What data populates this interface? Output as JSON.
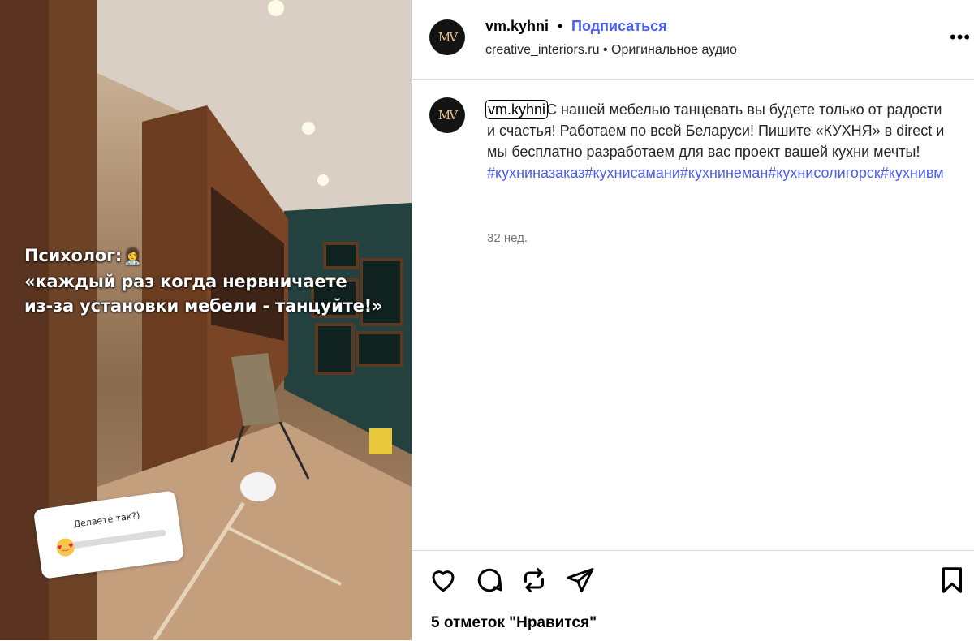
{
  "video": {
    "overlay_line1": "Психолог:",
    "overlay_line2": "«каждый раз когда нервничаете",
    "overlay_line3": "из-за установки мебели - танцуйте!»",
    "slider_question": "Делаете так?)",
    "slider_value": 0.0
  },
  "header": {
    "avatar_monogram": "MV",
    "username": "vm.kyhni",
    "separator": "•",
    "follow_label": "Подписаться",
    "subline": "creative_interiors.ru • Оригинальное аудио",
    "more_label": "•••"
  },
  "caption": {
    "avatar_monogram": "MV",
    "username": "vm.kyhni",
    "text": "С нашей мебелью танцевать вы будете только от радости и счастья! Работаем по всей Беларуси! Пишите «КУХНЯ» в direct и мы бесплатно разработаем для вас проект вашей кухни мечты!",
    "hashtags": "#кухниназаказ#кухнисамани#кухнинеман#кухнисолигорск#кухнивм",
    "time": "32 нед."
  },
  "actions": {
    "likes_text": "5 отметок \"Нравится\""
  },
  "colors": {
    "link_blue": "#4a5df9",
    "divider": "#dbdbdb",
    "muted": "#737373"
  }
}
